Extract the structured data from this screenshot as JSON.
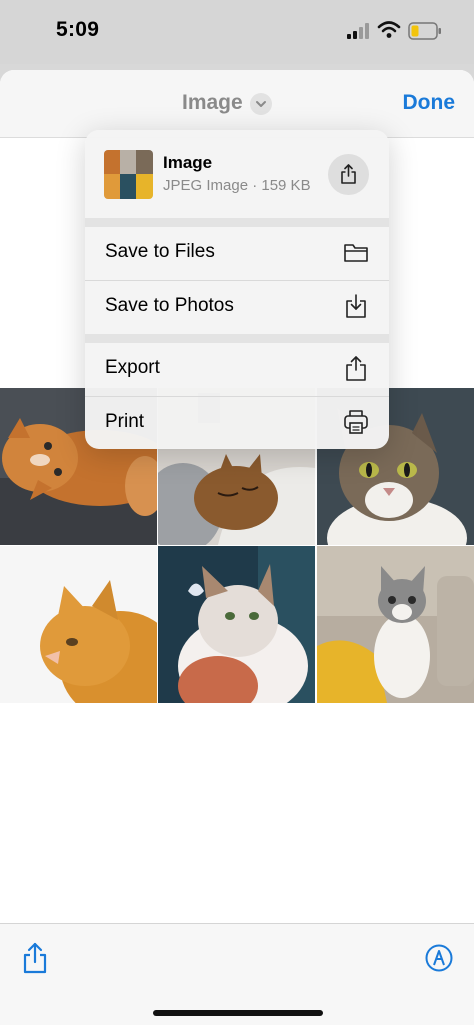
{
  "status": {
    "time": "5:09"
  },
  "nav": {
    "title": "Image",
    "done": "Done"
  },
  "menu": {
    "file_name": "Image",
    "file_info": "JPEG Image · 159 KB",
    "items": [
      {
        "label": "Save to Files",
        "icon": "folder-icon"
      },
      {
        "label": "Save to Photos",
        "icon": "download-icon"
      },
      {
        "label": "Export",
        "icon": "share-icon"
      },
      {
        "label": "Print",
        "icon": "printer-icon"
      }
    ]
  },
  "photos": [
    "orange cat lying",
    "tabby cat sleeping on blanket",
    "tabby cat with white chest",
    "orange cat profile",
    "cat with butterfly",
    "grey and white cat on sofa"
  ],
  "toolbar": {
    "left_icon": "share-icon",
    "right_icon": "markup-icon"
  },
  "colors": {
    "accent": "#1a7ad9",
    "battery": "#f2c40c"
  }
}
